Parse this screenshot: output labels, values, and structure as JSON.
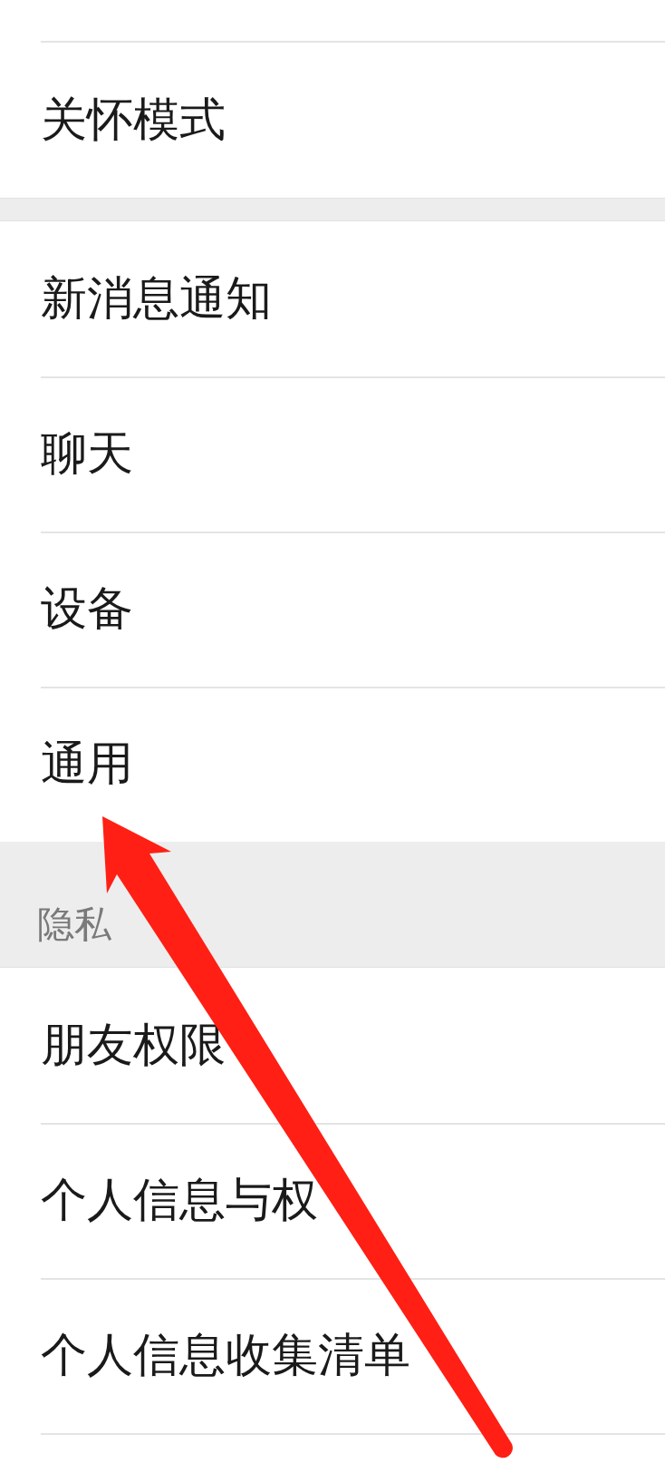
{
  "sections": [
    {
      "items": [
        {
          "label": "关怀模式"
        }
      ]
    },
    {
      "items": [
        {
          "label": "新消息通知"
        },
        {
          "label": "聊天"
        },
        {
          "label": "设备"
        },
        {
          "label": "通用"
        }
      ]
    },
    {
      "header": "隐私",
      "items": [
        {
          "label": "朋友权限"
        },
        {
          "label": "个人信息与权"
        },
        {
          "label": "个人信息收集清单"
        }
      ]
    }
  ],
  "annotation": {
    "kind": "arrow"
  }
}
